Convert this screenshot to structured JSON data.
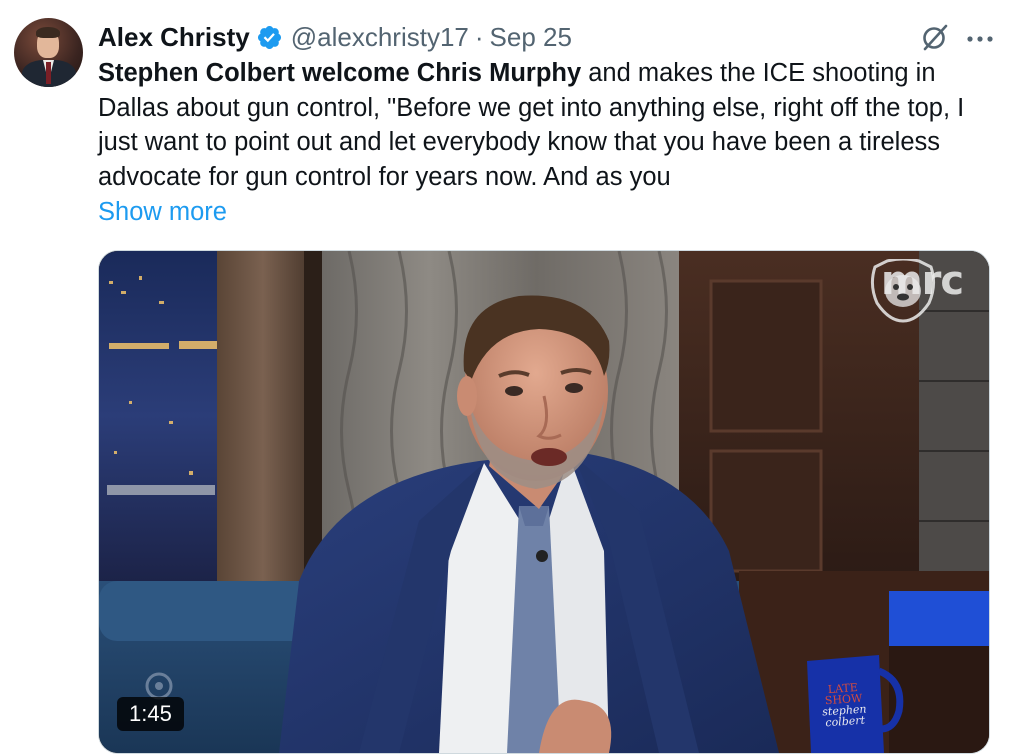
{
  "author": {
    "display_name": "Alex Christy",
    "handle": "@alexchristy17",
    "separator": "·",
    "date": "Sep 25",
    "avatar_icon": "avatar"
  },
  "icons": {
    "verified": "verified-badge-icon",
    "grok": "grok-icon",
    "more": "more-options-icon"
  },
  "colors": {
    "link": "#1d9bf0",
    "secondary_text": "#536471",
    "verified": "#1d9bf0"
  },
  "tweet": {
    "bold_text": "Stephen Colbert welcome Chris Murphy",
    "body_text": " and makes the ICE shooting in Dallas about gun control, \"Before we get into anything else, right off the top, I just want to point out and let everybody know that you have been a tireless advocate for gun control for years now. And as you",
    "show_more": "Show more"
  },
  "media": {
    "type": "video",
    "duration": "1:45",
    "watermark": "mrc",
    "mug_line1": "LATE",
    "mug_line2": "SHOW",
    "mug_line3": "stephen",
    "mug_line4": "colbert"
  }
}
